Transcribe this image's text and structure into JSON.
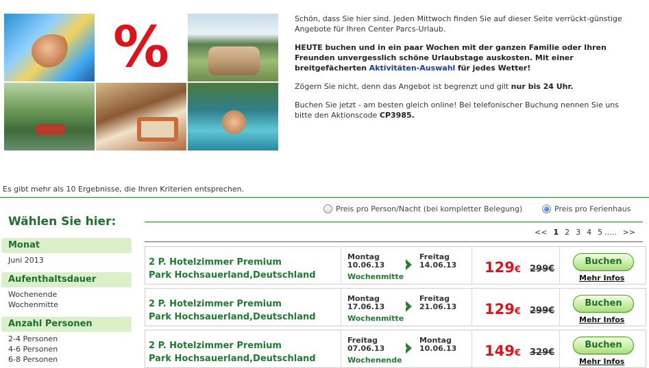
{
  "mosaic": {
    "tiles": [
      {
        "icon": "water-slide-photo"
      },
      {
        "icon": "percent-sign-graphic",
        "text": "%"
      },
      {
        "icon": "lake-terrace-photo"
      },
      {
        "icon": "canoe-forest-photo"
      },
      {
        "icon": "holiday-house-interior-photo"
      },
      {
        "icon": "pool-photo"
      }
    ]
  },
  "intro": {
    "p1": "Schön, dass Sie hier sind. Jeden Mittwoch finden Sie auf dieser Seite verrückt-günstige Angebote für Ihren Center Parcs-Urlaub.",
    "p2_bold": "HEUTE buchen und in ein paar Wochen mit der ganzen Familie oder Ihren Freunden unvergesslich schöne Urlaubstage auskosten. Mit einer breitgefächerten",
    "p2_link": "Aktivitäten-Auswahl",
    "p2_end": "für jedes Wetter!",
    "p3_start": "Zögern Sie nicht, denn das Angebot ist begrenzt und gilt",
    "p3_bold": "nur bis 24 Uhr.",
    "p4_start": "Buchen Sie jetzt - am besten gleich online! Bei telefonischer Buchung nennen Sie uns bitte den Aktionscode",
    "p4_code": "CP3985."
  },
  "results": {
    "text": "Es gibt mehr als 10 Ergebnisse, die Ihren Kriterien entsprechen."
  },
  "sidebar": {
    "title": "Wählen Sie hier:",
    "sections": [
      {
        "head": "Monat",
        "items": [
          "Juni 2013"
        ]
      },
      {
        "head": "Aufenthaltsdauer",
        "items": [
          "Wochenende",
          "Wochenmitte"
        ]
      },
      {
        "head": "Anzahl Personen",
        "items": [
          "2-4 Personen",
          "4-6 Personen",
          "6-8 Personen"
        ]
      }
    ]
  },
  "price_mode": {
    "option1": "Preis pro Person/Nacht (bei kompletter Belegung)",
    "option2": "Preis pro Ferienhaus",
    "selected": 2
  },
  "pager": {
    "prev": "<<",
    "pages": [
      "1",
      "2",
      "3",
      "4",
      "5"
    ],
    "ellipsis": ".....",
    "next": ">>",
    "current": "1"
  },
  "offers": [
    {
      "title1": "2 P. Hotelzimmer Premium",
      "title2": "Park Hochsauerland,Deutschland",
      "start_day": "Montag",
      "start_date": "10.06.13",
      "end_day": "Freitag",
      "end_date": "14.06.13",
      "stay": "Wochenmitte",
      "price": "129",
      "currency": "€",
      "old_price": "299€",
      "book": "Buchen",
      "more": "Mehr Infos"
    },
    {
      "title1": "2 P. Hotelzimmer Premium",
      "title2": "Park Hochsauerland,Deutschland",
      "start_day": "Montag",
      "start_date": "17.06.13",
      "end_day": "Freitag",
      "end_date": "21.06.13",
      "stay": "Wochenmitte",
      "price": "129",
      "currency": "€",
      "old_price": "299€",
      "book": "Buchen",
      "more": "Mehr Infos"
    },
    {
      "title1": "2 P. Hotelzimmer Premium",
      "title2": "Park Hochsauerland,Deutschland",
      "start_day": "Freitag",
      "start_date": "07.06.13",
      "end_day": "Montag",
      "end_date": "10.06.13",
      "stay": "Wochenende",
      "price": "149",
      "currency": "€",
      "old_price": "329€",
      "book": "Buchen",
      "more": "Mehr Infos"
    }
  ],
  "colors": {
    "accent_green": "#1f7a2f",
    "price_red": "#d8161b",
    "sidebar_head_bg": "#dbefc8"
  }
}
